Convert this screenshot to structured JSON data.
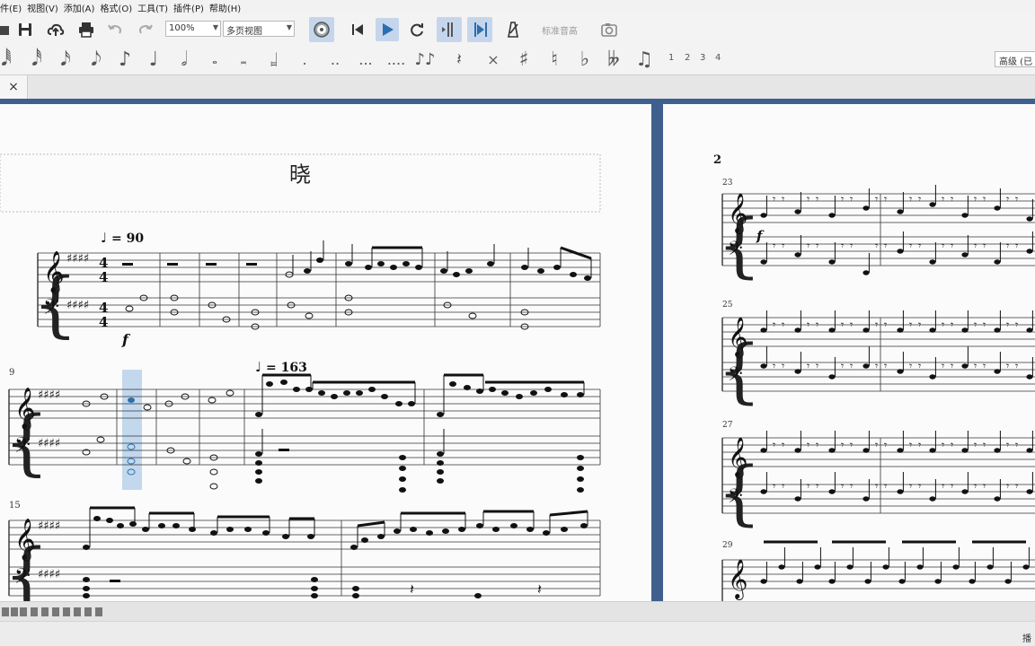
{
  "menu": [
    "件(E)",
    "视图(V)",
    "添加(A)",
    "格式(O)",
    "工具(T)",
    "插件(P)",
    "帮助(H)"
  ],
  "toolbar": {
    "zoom": "100%",
    "view_mode": "多页视图",
    "concert_pitch": "标准音高"
  },
  "palette": {
    "voices": [
      "1",
      "2",
      "3",
      "4"
    ],
    "workspace": "高级 (已"
  },
  "tab": {
    "close": "×"
  },
  "score": {
    "title": "晓",
    "tempo1": "= 90",
    "tempo2": "= 163",
    "dynamic1": "f",
    "dynamic2": "f",
    "page_number": "2",
    "measure_numbers_left": [
      "9",
      "15"
    ],
    "measure_numbers_right": [
      "23",
      "25",
      "27",
      "29"
    ]
  },
  "status": {
    "right": "播"
  }
}
